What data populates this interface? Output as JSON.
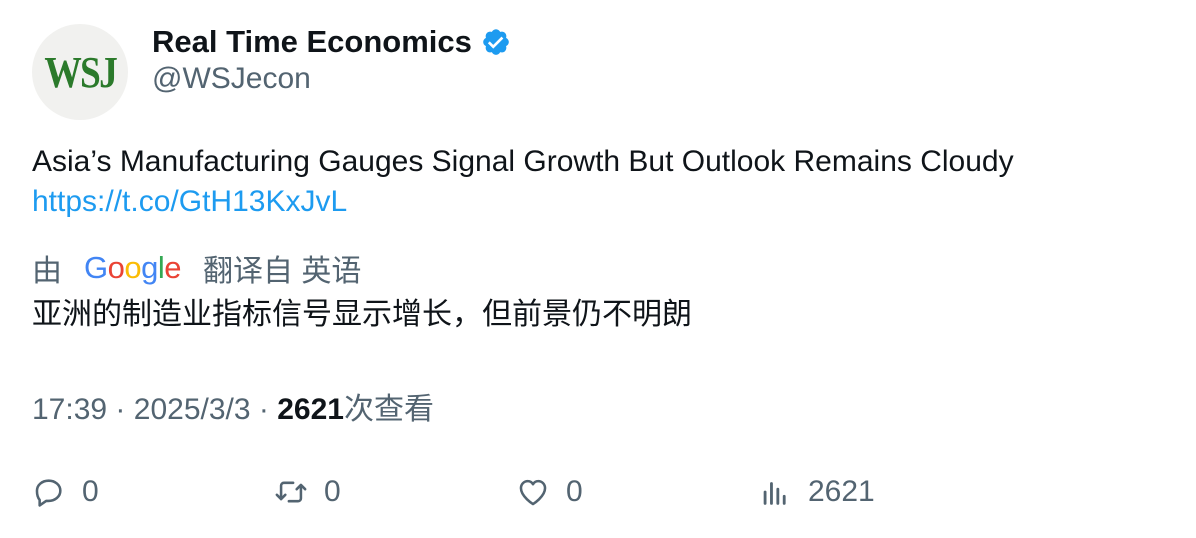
{
  "author": {
    "avatar_text": "WSJ",
    "display_name": "Real Time Economics",
    "handle": "@WSJecon",
    "verified_icon": "verified-badge-icon",
    "verified_color": "#1d9bf0"
  },
  "tweet": {
    "text": "Asia’s Manufacturing Gauges Signal Growth But Outlook Remains Cloudy",
    "link": "https://t.co/GtH13KxJvL"
  },
  "translation": {
    "prefix": "由",
    "provider": "Google",
    "suffix": "翻译自 英语",
    "text": "亚洲的制造业指标信号显示增长，但前景仍不明朗"
  },
  "meta": {
    "time": "17:39",
    "separator": "·",
    "date": "2025/3/3",
    "views_count": "2621",
    "views_label": "次查看"
  },
  "actions": {
    "reply_count": "0",
    "retweet_count": "0",
    "like_count": "0",
    "views_count": "2621"
  },
  "colors": {
    "link": "#1d9bf0",
    "secondary_text": "#536471",
    "primary_text": "#0f1419"
  }
}
